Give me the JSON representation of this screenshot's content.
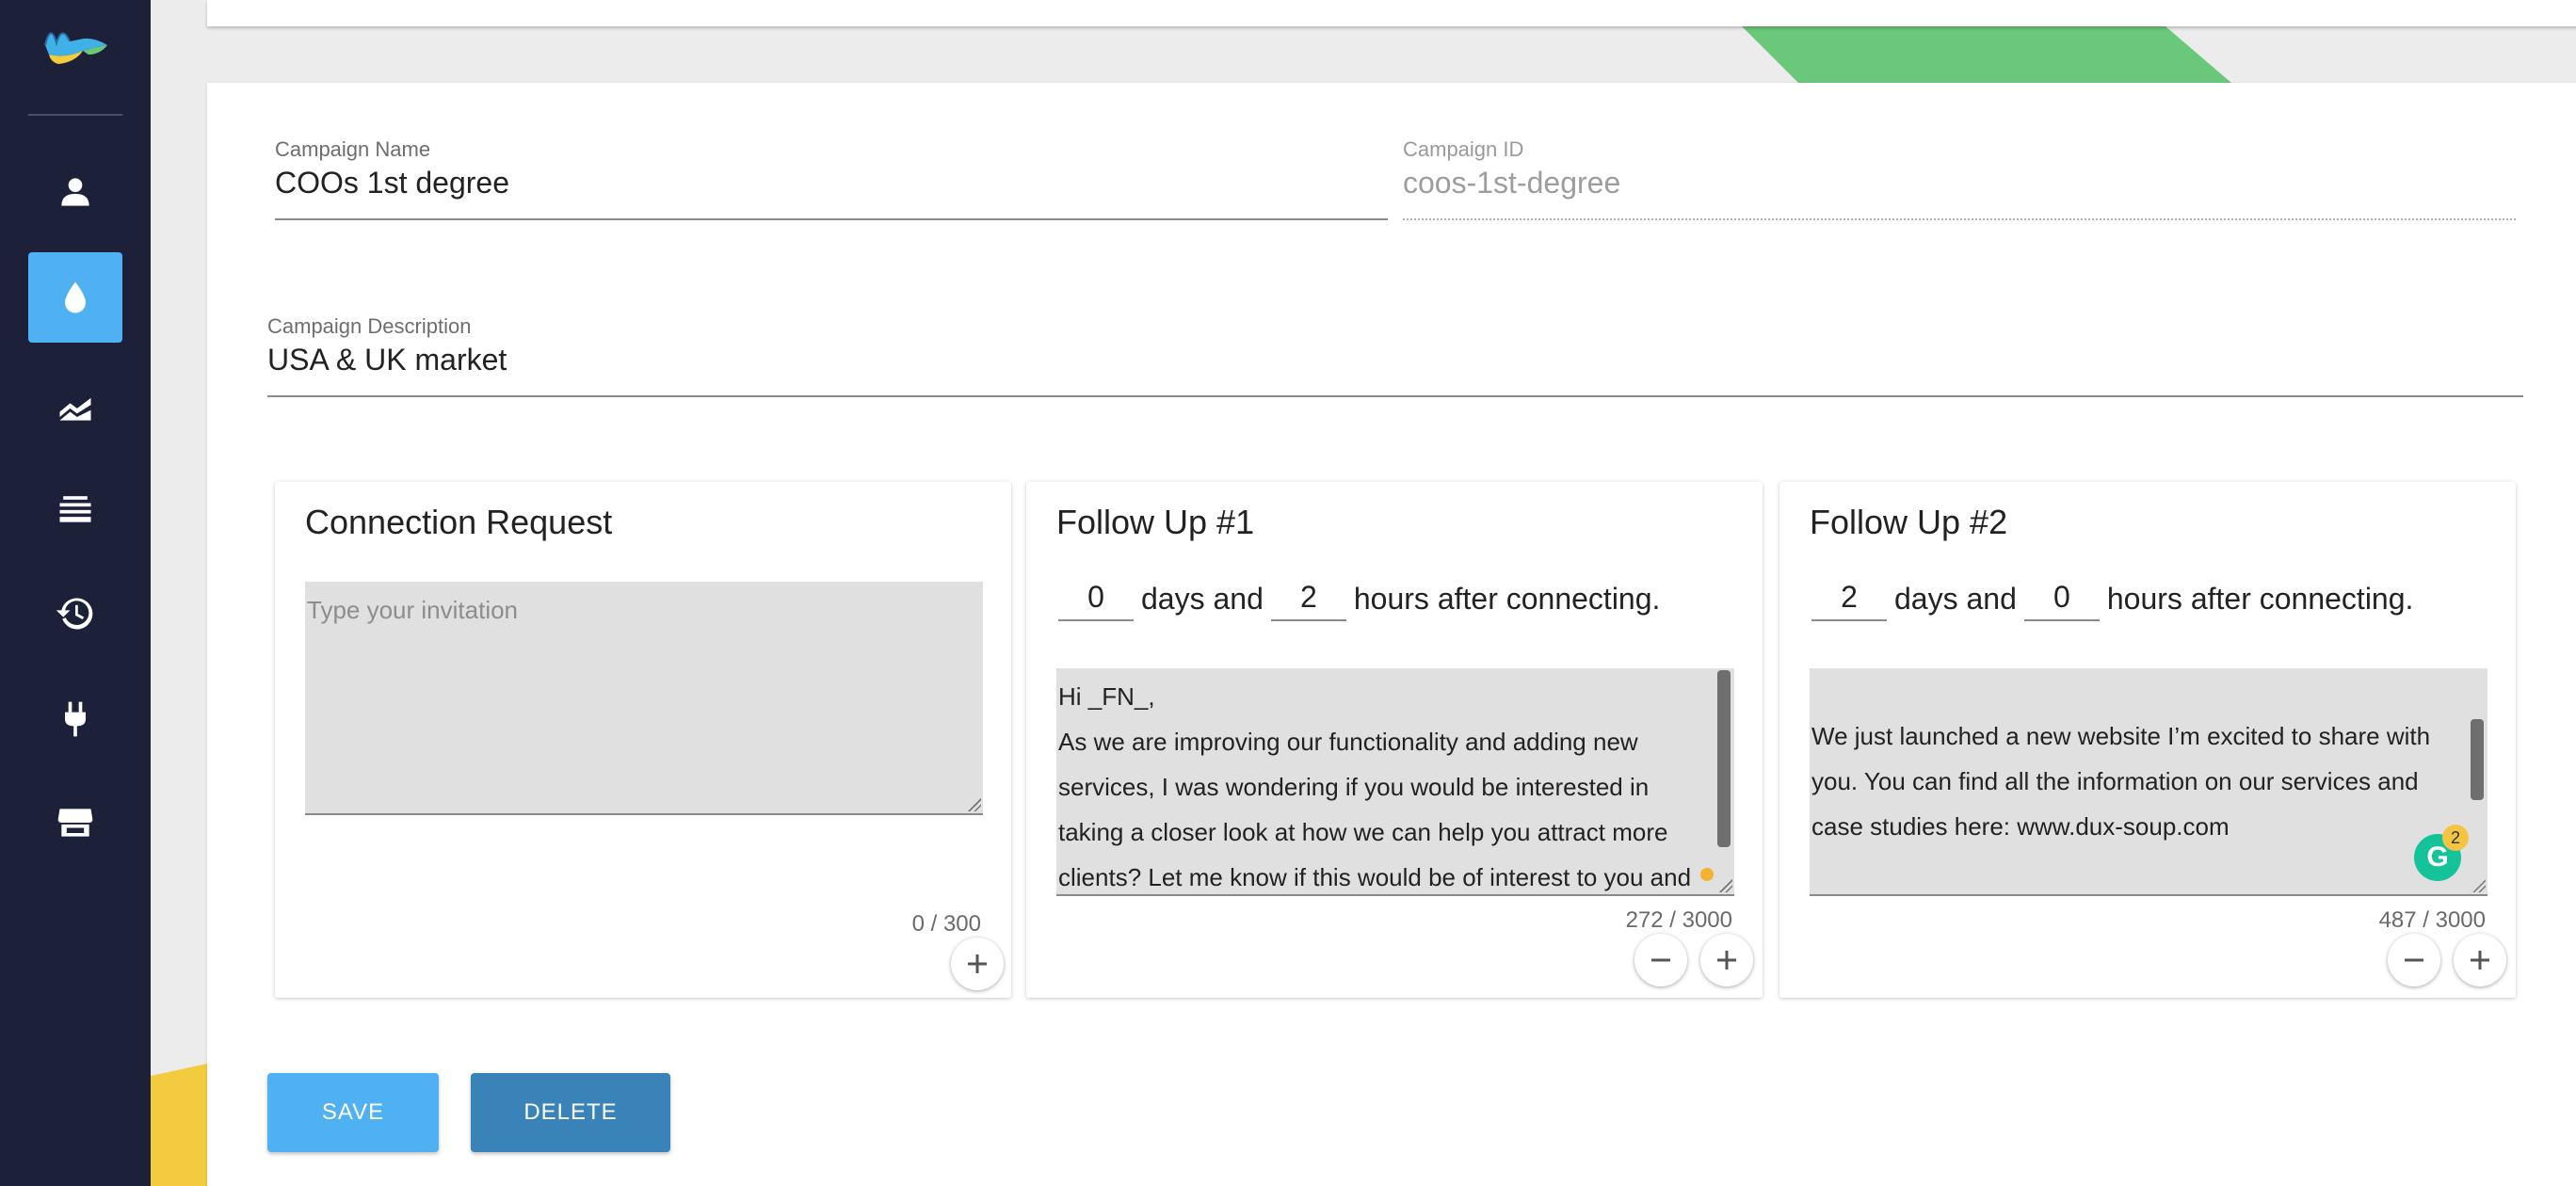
{
  "sidebar": {
    "items": [
      {
        "icon": "person-icon",
        "active": false
      },
      {
        "icon": "drop-icon",
        "active": true
      },
      {
        "icon": "chart-icon",
        "active": false
      },
      {
        "icon": "list-icon",
        "active": false
      },
      {
        "icon": "history-icon",
        "active": false
      },
      {
        "icon": "plug-icon",
        "active": false
      },
      {
        "icon": "store-icon",
        "active": false
      }
    ]
  },
  "form": {
    "campaign_name": {
      "label": "Campaign Name",
      "value": "COOs 1st degree"
    },
    "campaign_id": {
      "label": "Campaign ID",
      "value": "coos-1st-degree"
    },
    "campaign_description": {
      "label": "Campaign Description",
      "value": "USA & UK market"
    }
  },
  "messages": {
    "connection": {
      "title": "Connection Request",
      "placeholder": "Type your invitation",
      "counter": "0 / 300"
    },
    "followup1": {
      "title": "Follow Up #1",
      "days": "0",
      "days_text": "days and",
      "hours": "2",
      "hours_text": "hours after connecting.",
      "lines": [
        "Hi _FN_,",
        "As we are improving our functionality and adding new",
        "services, I was wondering if you would be interested in",
        "taking a closer look at how we can help you attract more",
        "clients? Let me know if this would be of interest to you and"
      ],
      "counter": "272 / 3000"
    },
    "followup2": {
      "title": "Follow Up #2",
      "days": "2",
      "days_text": "days and",
      "hours": "0",
      "hours_text": "hours after connecting.",
      "lines": [
        "We just launched a new website I’m excited to share with",
        "you. You can find all the information on our services and",
        "case studies here: www.dux-soup.com"
      ],
      "counter": "487 / 3000",
      "grammarly_letter": "G",
      "grammarly_count": "2"
    }
  },
  "actions": {
    "save": "SAVE",
    "delete": "DELETE"
  },
  "colors": {
    "sidebar": "#1c2039",
    "accent": "#4fb0f2",
    "delete": "#3a83b8",
    "green": "#6ac87a",
    "yellow": "#f2cb3f"
  }
}
